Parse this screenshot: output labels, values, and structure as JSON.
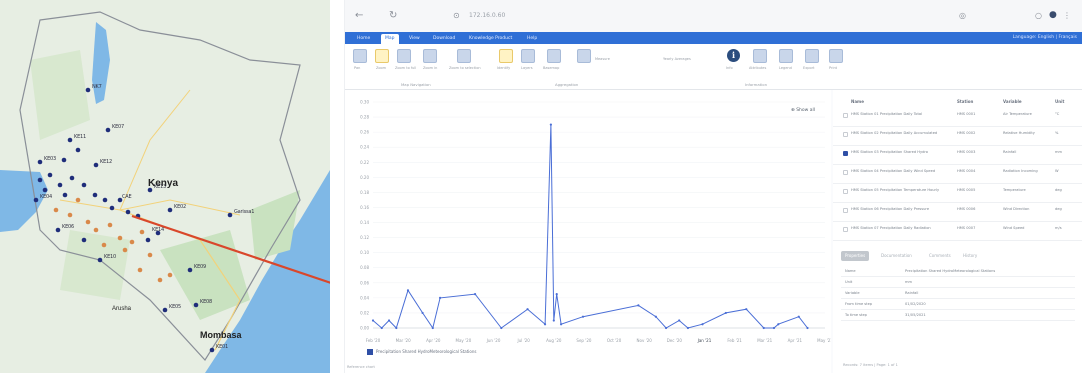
{
  "map": {
    "city_large": "Kenya",
    "city_coast": "Mombasa",
    "city_small": "Arusha",
    "station_labels": [
      "NK7",
      "KE07",
      "KE11",
      "KE12",
      "KE13",
      "CAE",
      "Garissa1",
      "KE09",
      "KE08",
      "KE05",
      "KE01",
      "KE02",
      "KE06",
      "KE10",
      "KE14",
      "KE04",
      "KE03"
    ],
    "colors": {
      "land": "#e7eee3",
      "water": "#7fb8e6",
      "park": "#c9e2c0",
      "pin_blue": "#1f2d7a",
      "pin_orange": "#d9894a",
      "arrow": "#d9472b"
    }
  },
  "browser": {
    "url": "172.16.0.60",
    "tabs": [
      "Home",
      "Map",
      "View",
      "Download",
      "Knowledge Product",
      "Help"
    ],
    "active_tab": "Map",
    "language": "Language: English | Français"
  },
  "ribbon": {
    "buttons": [
      "Pan",
      "Zoom",
      "Zoom to full",
      "Zoom in",
      "Zoom to selection",
      "Identify",
      "Layers",
      "Basemap",
      "Measure",
      "Info",
      "Attributes",
      "Legend",
      "Export",
      "Print"
    ],
    "time_label": "Yearly Averages",
    "groups": [
      "Map Navigation",
      "Aggregation",
      "Information"
    ]
  },
  "chart_controls": {
    "show_all": "Show all",
    "legend_entry": "Precipitation Shared HydroMeteorological Stations",
    "footnote": "Reference chart"
  },
  "chart_data": {
    "type": "line",
    "color": "#4a6ed6",
    "x_tick_labels": [
      "Feb '20",
      "Mar '20",
      "Apr '20",
      "May '20",
      "Jun '20",
      "Jul '20",
      "Aug '20",
      "Sep '20",
      "Oct '20",
      "Nov '20",
      "Dec '20",
      "Jan '21",
      "Feb '21",
      "Mar '21",
      "Apr '21",
      "May '21"
    ],
    "y_tick_labels": [
      "0.00",
      "0.02",
      "0.04",
      "0.06",
      "0.08",
      "0.10",
      "0.12",
      "0.14",
      "0.16",
      "0.18",
      "0.20",
      "0.22",
      "0.24",
      "0.26",
      "0.28",
      "0.30"
    ],
    "ylim": [
      0,
      0.3
    ],
    "xlim": [
      0,
      15.5
    ],
    "x": [
      0,
      0.3,
      0.55,
      0.8,
      1.2,
      1.7,
      2.05,
      2.3,
      3.5,
      4.4,
      5.3,
      5.9,
      6.1,
      6.2,
      6.3,
      6.45,
      7.2,
      9.1,
      9.7,
      10.05,
      10.5,
      10.8,
      11.3,
      12.1,
      12.8,
      13.4,
      13.75,
      13.9,
      14.6,
      14.9
    ],
    "values": [
      0.01,
      0.0,
      0.01,
      0.0,
      0.05,
      0.02,
      0.0,
      0.04,
      0.045,
      0.0,
      0.025,
      0.005,
      0.27,
      0.01,
      0.045,
      0.005,
      0.015,
      0.03,
      0.015,
      0.0,
      0.01,
      0.0,
      0.005,
      0.02,
      0.025,
      0.0,
      0.0,
      0.005,
      0.015,
      0.0
    ]
  },
  "side_panel": {
    "headers": [
      "Name",
      "Station",
      "Variable",
      "Unit"
    ],
    "rows": [
      {
        "name": "HMS Station 01 Precipitation Daily Total",
        "station": "HMS 0001",
        "variable": "Air Temperature",
        "unit": "°C",
        "checked": false
      },
      {
        "name": "HMS Station 02 Precipitation Daily Accumulated",
        "station": "HMS 0002",
        "variable": "Relative Humidity",
        "unit": "%",
        "checked": false
      },
      {
        "name": "HMS Station 03 Precipitation Shared Hydro",
        "station": "HMS 0003",
        "variable": "Rainfall",
        "unit": "mm",
        "checked": true
      },
      {
        "name": "HMS Station 04 Precipitation Daily Wind Speed",
        "station": "HMS 0004",
        "variable": "Radiation Incoming",
        "unit": "W",
        "checked": false
      },
      {
        "name": "HMS Station 05 Precipitation Temperature Hourly",
        "station": "HMS 0005",
        "variable": "Temperature",
        "unit": "deg",
        "checked": false
      },
      {
        "name": "HMS Station 06 Precipitation Daily Pressure",
        "station": "HMS 0006",
        "variable": "Wind Direction",
        "unit": "deg",
        "checked": false
      },
      {
        "name": "HMS Station 07 Precipitation Daily Radiation",
        "station": "HMS 0007",
        "variable": "Wind Speed",
        "unit": "m/s",
        "checked": false
      }
    ],
    "tabs": [
      "Properties",
      "Documentation",
      "Comments",
      "History"
    ],
    "properties": [
      {
        "key": "Name",
        "value": "Precipitation Shared HydroMeteorological Stations"
      },
      {
        "key": "Unit",
        "value": "mm"
      },
      {
        "key": "Variable",
        "value": "Rainfall"
      },
      {
        "key": "From time step",
        "value": "01/02/2020"
      },
      {
        "key": "To time step",
        "value": "31/05/2021"
      }
    ],
    "footer": "Records: 7 items | Page: 1 of 1"
  }
}
